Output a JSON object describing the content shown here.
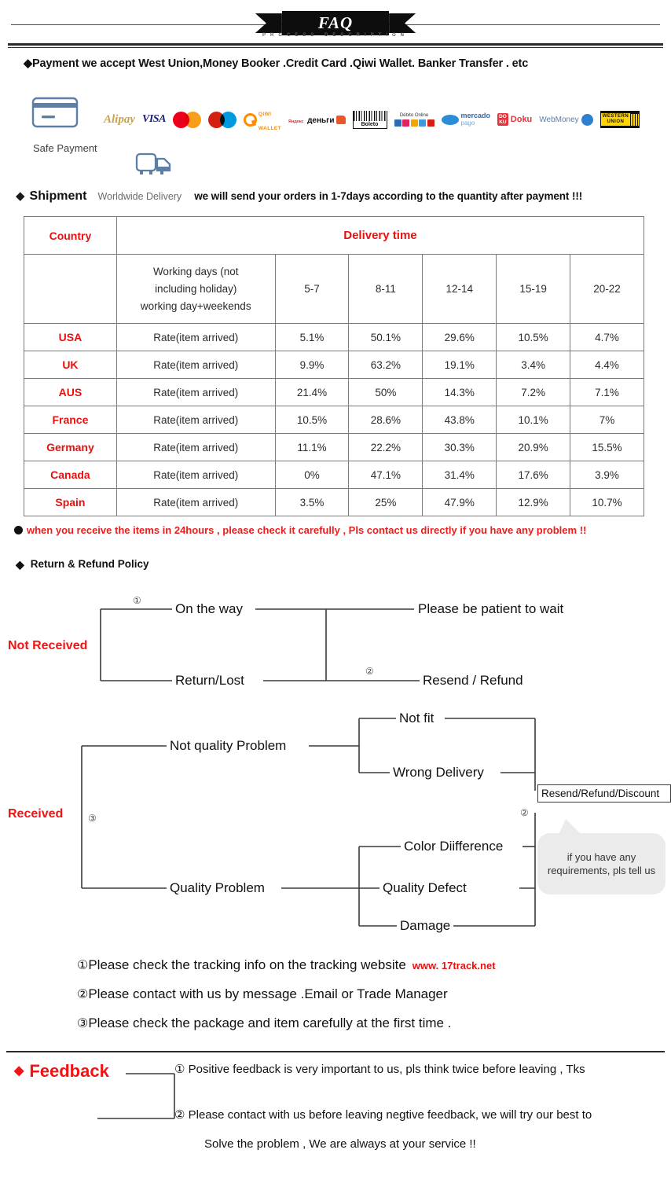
{
  "banner": {
    "title": "FAQ",
    "subtitle": "PROCESS DESCRIPTION"
  },
  "payment": {
    "headline": "◆Payment we accept West Union,Money Booker .Credit Card .Qiwi Wallet. Banker Transfer . etc",
    "safe_payment_label": "Safe Payment",
    "card_icon": "credit-card-icon",
    "logos": [
      {
        "name": "alipay-logo",
        "label": "Alipay"
      },
      {
        "name": "visa-logo",
        "label": "VISA"
      },
      {
        "name": "mastercard-logo",
        "label": "Mastercard"
      },
      {
        "name": "maestro-logo",
        "label": "Maestro"
      },
      {
        "name": "qiwi-wallet-logo",
        "label": "QIWI",
        "label2": "WALLET"
      },
      {
        "name": "yandex-money-logo",
        "label": "Яндекс",
        "label2": "деньги"
      },
      {
        "name": "boleto-logo",
        "label": "Boleto"
      },
      {
        "name": "debito-online-logo",
        "label": "Débito Online"
      },
      {
        "name": "mercado-pago-logo",
        "label": "mercado",
        "label2": "pago"
      },
      {
        "name": "doku-logo",
        "label": "DO",
        "label2": "KU",
        "label3": "Doku"
      },
      {
        "name": "webmoney-logo",
        "label": "WebMoney"
      },
      {
        "name": "western-union-logo",
        "label": "WESTERN",
        "label2": "UNION"
      }
    ]
  },
  "shipment": {
    "truck_icon": "delivery-truck-icon",
    "diamond": "◆",
    "title": "Shipment",
    "worldwide": "Worldwide Delivery",
    "text": "we will send your orders in 1-7days according to the quantity after payment  !!!"
  },
  "chart_data": {
    "type": "table",
    "title": "Delivery time",
    "header_country": "Country",
    "header_delivery": "Delivery time",
    "subheader_working": "Working days (not including holiday) working day+weekends",
    "subheader_working_lines": [
      "Working days (not",
      "including holiday)",
      "working day+weekends"
    ],
    "categories": [
      "5-7",
      "8-11",
      "12-14",
      "15-19",
      "20-22"
    ],
    "rate_label": "Rate(item arrived)",
    "series": [
      {
        "name": "USA",
        "values": [
          "5.1%",
          "50.1%",
          "29.6%",
          "10.5%",
          "4.7%"
        ]
      },
      {
        "name": "UK",
        "values": [
          "9.9%",
          "63.2%",
          "19.1%",
          "3.4%",
          "4.4%"
        ]
      },
      {
        "name": "AUS",
        "values": [
          "21.4%",
          "50%",
          "14.3%",
          "7.2%",
          "7.1%"
        ]
      },
      {
        "name": "France",
        "values": [
          "10.5%",
          "28.6%",
          "43.8%",
          "10.1%",
          "7%"
        ]
      },
      {
        "name": "Germany",
        "values": [
          "11.1%",
          "22.2%",
          "30.3%",
          "20.9%",
          "15.5%"
        ]
      },
      {
        "name": "Canada",
        "values": [
          "0%",
          "47.1%",
          "31.4%",
          "17.6%",
          "3.9%"
        ]
      },
      {
        "name": "Spain",
        "values": [
          "3.5%",
          "25%",
          "47.9%",
          "12.9%",
          "10.7%"
        ]
      }
    ],
    "xlabel": "Delivery time",
    "ylabel": "Country",
    "grid": true,
    "legend": "none"
  },
  "notice": {
    "text": "when you receive the items in 24hours , please check it carefully , Pls contact us directly if you have any problem !!"
  },
  "return_policy": {
    "diamond": "◆",
    "title": "Return & Refund Policy"
  },
  "not_received": {
    "root": "Not Received",
    "num1": "①",
    "num2": "②",
    "branch1": "On the way",
    "branch2": "Return/Lost",
    "result1": "Please be patient to wait",
    "result2": "Resend / Refund"
  },
  "received": {
    "root": "Received",
    "num3": "③",
    "num2": "②",
    "branch1": "Not quality Problem",
    "branch2": "Quality Problem",
    "leaf1": "Not fit",
    "leaf2": "Wrong Delivery",
    "leaf3": "Color Diifference",
    "leaf4": "Quality Defect",
    "leaf5": "Damage",
    "outcome_box": "Resend/Refund/Discount",
    "bubble_line1": "if you have any",
    "bubble_line2": "requirements, pls tell us"
  },
  "steps": [
    {
      "num": "①",
      "text": "Please check the tracking info on the tracking website",
      "link": "www. 17track.net"
    },
    {
      "num": "②",
      "text": "Please contact with us by message .Email or Trade Manager",
      "link": ""
    },
    {
      "num": "③",
      "text": "Please check the package and item carefully at the first time .",
      "link": ""
    }
  ],
  "feedback": {
    "diamond": "◆",
    "title": "Feedback",
    "item1": "① Positive feedback is very important to us, pls think twice before leaving , Tks",
    "item2": "② Please contact with us before leaving negtive feedback, we will try our best to",
    "item2b": "Solve the problem , We are always at your service !!"
  },
  "colors": {
    "red": "#f01414",
    "dark_red": "#e8110f",
    "black": "#111111",
    "icon_blue": "#5b7fa6"
  }
}
